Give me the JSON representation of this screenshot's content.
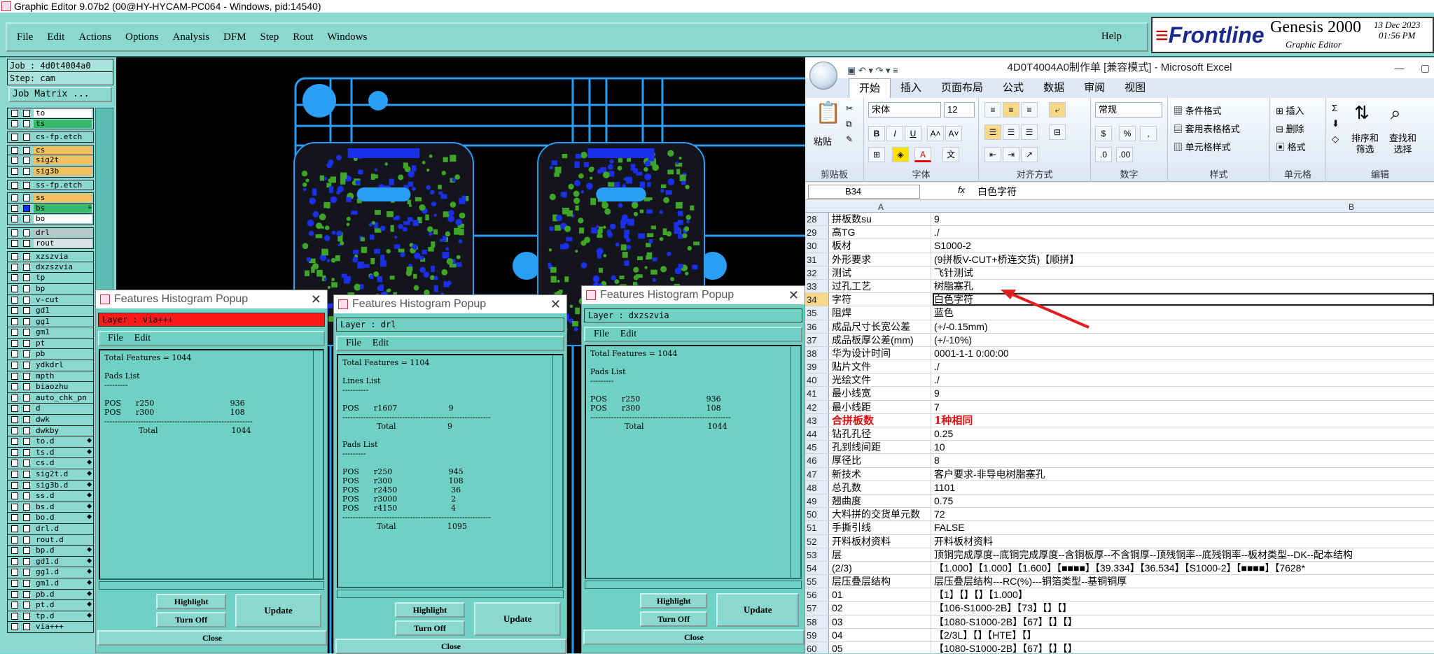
{
  "titlebar": "Graphic Editor 9.07b2 (00@HY-HYCAM-PC064 - Windows, pid:14540)",
  "menubar": {
    "items": [
      "File",
      "Edit",
      "Actions",
      "Options",
      "Analysis",
      "DFM",
      "Step",
      "Rout",
      "Windows"
    ],
    "help": "Help"
  },
  "logo": {
    "frontline": "Frontline",
    "product": "Genesis 2000",
    "subtitle": "Graphic Editor",
    "date": "13 Dec 2023",
    "time": "01:56 PM"
  },
  "job": {
    "job_label": "Job : 4d0t4004a0",
    "step_label": "Step: cam",
    "matrix_button": "Job Matrix ..."
  },
  "layers": [
    {
      "name": "to",
      "color": "#ffffff"
    },
    {
      "name": "ts",
      "color": "#38b86a"
    },
    {
      "name": "cs-fp.etch",
      "color": "#8ad8d0",
      "gap": true
    },
    {
      "name": "cs",
      "color": "#f5c060",
      "gap": true
    },
    {
      "name": "sig2t",
      "color": "#f5c060"
    },
    {
      "name": "sig3b",
      "color": "#f5c060"
    },
    {
      "name": "ss-fp.etch",
      "color": "#8ad8d0",
      "gap": true
    },
    {
      "name": "ss",
      "color": "#f5c060",
      "gap": true
    },
    {
      "name": "bs",
      "color": "#38b86a",
      "mark": "≡"
    },
    {
      "name": "bo",
      "color": "#ffffff"
    },
    {
      "name": "drl",
      "color": "#b8c8c8",
      "gap": true
    },
    {
      "name": "rout",
      "color": "#d8e4e4"
    },
    {
      "name": "xzszvia",
      "color": "#8ad8d0",
      "gap": true
    },
    {
      "name": "dxzszvia",
      "color": "#8ad8d0"
    },
    {
      "name": "tp",
      "color": "#8ad8d0"
    },
    {
      "name": "bp",
      "color": "#8ad8d0"
    },
    {
      "name": "v-cut",
      "color": "#8ad8d0"
    },
    {
      "name": "gd1",
      "color": "#8ad8d0"
    },
    {
      "name": "gg1",
      "color": "#8ad8d0"
    },
    {
      "name": "gm1",
      "color": "#8ad8d0"
    },
    {
      "name": "pt",
      "color": "#8ad8d0"
    },
    {
      "name": "pb",
      "color": "#8ad8d0"
    },
    {
      "name": "ydkdrl",
      "color": "#8ad8d0"
    },
    {
      "name": "mpth",
      "color": "#8ad8d0"
    },
    {
      "name": "biaozhu",
      "color": "#8ad8d0"
    },
    {
      "name": "auto_chk_pn",
      "color": "#8ad8d0"
    },
    {
      "name": "d",
      "color": "#8ad8d0"
    },
    {
      "name": "dwk",
      "color": "#8ad8d0"
    },
    {
      "name": "dwkby",
      "color": "#8ad8d0"
    },
    {
      "name": "to.d",
      "color": "#8ad8d0",
      "mark": "◆"
    },
    {
      "name": "ts.d",
      "color": "#8ad8d0",
      "mark": "◆"
    },
    {
      "name": "cs.d",
      "color": "#8ad8d0",
      "mark": "◆"
    },
    {
      "name": "sig2t.d",
      "color": "#8ad8d0",
      "mark": "◆"
    },
    {
      "name": "sig3b.d",
      "color": "#8ad8d0",
      "mark": "◆"
    },
    {
      "name": "ss.d",
      "color": "#8ad8d0",
      "mark": "◆"
    },
    {
      "name": "bs.d",
      "color": "#8ad8d0",
      "mark": "◆"
    },
    {
      "name": "bo.d",
      "color": "#8ad8d0",
      "mark": "◆"
    },
    {
      "name": "drl.d",
      "color": "#8ad8d0"
    },
    {
      "name": "rout.d",
      "color": "#8ad8d0"
    },
    {
      "name": "bp.d",
      "color": "#8ad8d0",
      "mark": "◆"
    },
    {
      "name": "gd1.d",
      "color": "#8ad8d0",
      "mark": "◆"
    },
    {
      "name": "gg1.d",
      "color": "#8ad8d0",
      "mark": "◆"
    },
    {
      "name": "gm1.d",
      "color": "#8ad8d0",
      "mark": "◆"
    },
    {
      "name": "pb.d",
      "color": "#8ad8d0",
      "mark": "◆"
    },
    {
      "name": "pt.d",
      "color": "#8ad8d0",
      "mark": "◆"
    },
    {
      "name": "tp.d",
      "color": "#8ad8d0",
      "mark": "◆"
    },
    {
      "name": "via+++",
      "color": "#8ad8d0"
    }
  ],
  "popups": [
    {
      "title": "Features Histogram Popup",
      "layer": "Layer : via+++",
      "layer_bg": "#ff1a1a",
      "menu": [
        "File",
        "Edit"
      ],
      "list": "Total Features = 1044\n\nPads List\n---------\n\nPOS      r250                               936\nPOS      r300                               108\n---------------------------------------------------------\n              Total                              1044",
      "highlight": "Highlight",
      "turnoff": "Turn Off",
      "update": "Update",
      "close": "Close"
    },
    {
      "title": "Features Histogram Popup",
      "layer": "Layer : drl",
      "layer_bg": "#6fd1c3",
      "menu": [
        "File",
        "Edit"
      ],
      "list": "Total Features = 1104\n\nLines List\n----------\n\nPOS      r1607                     9\n---------------------------------------------------------\n              Total                     9\n\nPads List\n---------\n\nPOS      r250                       945\nPOS      r300                       108\nPOS      r2450                      36\nPOS      r3000                      2\nPOS      r4150                      4\n---------------------------------------------------------\n              Total                     1095",
      "highlight": "Highlight",
      "turnoff": "Turn Off",
      "update": "Update",
      "close": "Close"
    },
    {
      "title": "Features Histogram Popup",
      "layer": "Layer : dxzszvia",
      "layer_bg": "#6fd1c3",
      "menu": [
        "File",
        "Edit"
      ],
      "list": "Total Features = 1044\n\nPads List\n---------\n\nPOS      r250                           936\nPOS      r300                           108\n------------------------------------------------------\n              Total                          1044",
      "highlight": "Highlight",
      "turnoff": "Turn Off",
      "update": "Update",
      "close": "Close"
    }
  ],
  "excel": {
    "title": "4D0T4004A0制作单  [兼容模式] - Microsoft Excel",
    "tabs": [
      "开始",
      "插入",
      "页面布局",
      "公式",
      "数据",
      "审阅",
      "视图"
    ],
    "ribbon": {
      "clipboard": {
        "paste": "粘贴",
        "label": "剪贴板"
      },
      "font": {
        "name": "宋体",
        "size": "12",
        "label": "字体"
      },
      "align": {
        "label": "对齐方式"
      },
      "number": {
        "format": "常规",
        "label": "数字"
      },
      "styles": {
        "cond": "条件格式",
        "table": "套用表格格式",
        "cell": "单元格样式",
        "label": "样式"
      },
      "cells": {
        "insert": "插入",
        "delete": "删除",
        "format": "格式",
        "label": "单元格"
      },
      "editing": {
        "sort": "排序和\n筛选",
        "find": "查找和\n选择",
        "label": "编辑"
      }
    },
    "namebox": "B34",
    "fx": "fx",
    "formula": "白色字符",
    "col_a": "A",
    "col_b": "B",
    "rows": [
      {
        "n": "28",
        "a": "拼板数su",
        "b": "9"
      },
      {
        "n": "29",
        "a": "高TG",
        "b": "./"
      },
      {
        "n": "30",
        "a": "板材",
        "b": "S1000-2"
      },
      {
        "n": "31",
        "a": "外形要求",
        "b": "(9拼板V-CUT+桥连交货)【顺拼】"
      },
      {
        "n": "32",
        "a": "测试",
        "b": "飞针测试"
      },
      {
        "n": "33",
        "a": "过孔工艺",
        "b": "树脂塞孔"
      },
      {
        "n": "34",
        "a": "字符",
        "b": "白色字符",
        "sel": true
      },
      {
        "n": "35",
        "a": "阻焊",
        "b": "蓝色"
      },
      {
        "n": "36",
        "a": "成品尺寸长宽公差",
        "b": "(+/-0.15mm)"
      },
      {
        "n": "37",
        "a": "成品板厚公差(mm)",
        "b": "(+/-10%)"
      },
      {
        "n": "38",
        "a": "华为设计时间",
        "b": "0001-1-1 0:00:00"
      },
      {
        "n": "39",
        "a": "贴片文件",
        "b": "./"
      },
      {
        "n": "40",
        "a": "光绘文件",
        "b": "./"
      },
      {
        "n": "41",
        "a": "最小线宽",
        "b": "9"
      },
      {
        "n": "42",
        "a": "最小线距",
        "b": "7"
      },
      {
        "n": "43",
        "a": "合拼板数",
        "b": "1种相同",
        "big": true
      },
      {
        "n": "44",
        "a": "钻孔孔径",
        "b": "0.25"
      },
      {
        "n": "45",
        "a": "孔到线间距",
        "b": "10"
      },
      {
        "n": "46",
        "a": "厚径比",
        "b": "8"
      },
      {
        "n": "47",
        "a": "新技术",
        "b": "客户要求-非导电树脂塞孔"
      },
      {
        "n": "48",
        "a": "总孔数",
        "b": "1101"
      },
      {
        "n": "49",
        "a": "翘曲度",
        "b": "0.75"
      },
      {
        "n": "50",
        "a": "大料拼的交货单元数",
        "b": "72"
      },
      {
        "n": "51",
        "a": "手撕引线",
        "b": "FALSE"
      },
      {
        "n": "52",
        "a": "开料板材资料",
        "b": "开料板材资料"
      },
      {
        "n": "53",
        "a": "层",
        "b": "顶铜完成厚度--底铜完成厚度--含铜板厚--不含铜厚--顶残铜率--底残铜率--板材类型--DK--配本结构"
      },
      {
        "n": "54",
        "a": "(2/3)",
        "b": "【1.000】【1.000】【1.600】【■■■■】【39.334】【36.534】【S1000-2】【■■■■】【7628*"
      },
      {
        "n": "55",
        "a": "层压叠层结构",
        "b": "层压叠层结构---RC(%)---铜箔类型--基铜铜厚"
      },
      {
        "n": "56",
        "a": "01",
        "b": "【1】【】【】【1.000】"
      },
      {
        "n": "57",
        "a": "02",
        "b": "【106-S1000-2B】【73】【】【】"
      },
      {
        "n": "58",
        "a": "03",
        "b": "【1080-S1000-2B】【67】【】【】"
      },
      {
        "n": "59",
        "a": "04",
        "b": "【2/3L】【】【HTE】【】"
      },
      {
        "n": "60",
        "a": "05",
        "b": "【1080-S1000-2B】【67】【】【】"
      }
    ]
  }
}
